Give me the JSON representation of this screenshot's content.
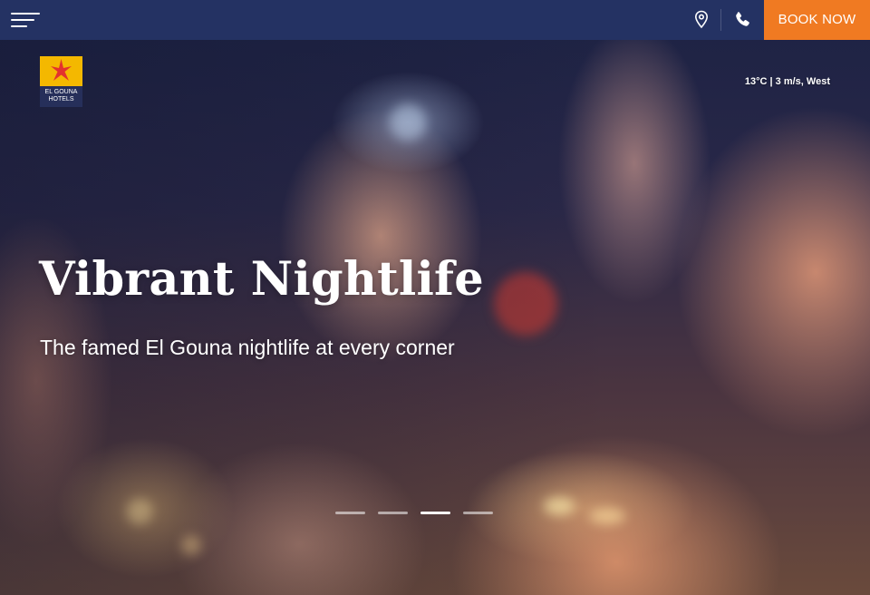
{
  "header": {
    "book_now_label": "BOOK NOW",
    "icons": [
      "menu-icon",
      "location-pin-icon",
      "phone-icon"
    ],
    "colors": {
      "bar": "#243263",
      "book_button": "#f07a22"
    }
  },
  "logo": {
    "line1": "EL GOUNA",
    "line2": "HOTELS",
    "badge_color": "#f4b800",
    "icon": "starfish-icon"
  },
  "weather": {
    "text": "13°C | 3 m/s, West"
  },
  "hero": {
    "title": "Vibrant Nightlife",
    "subtitle": "The famed El Gouna nightlife at every corner"
  },
  "slider": {
    "count": 4,
    "active_index": 2
  }
}
